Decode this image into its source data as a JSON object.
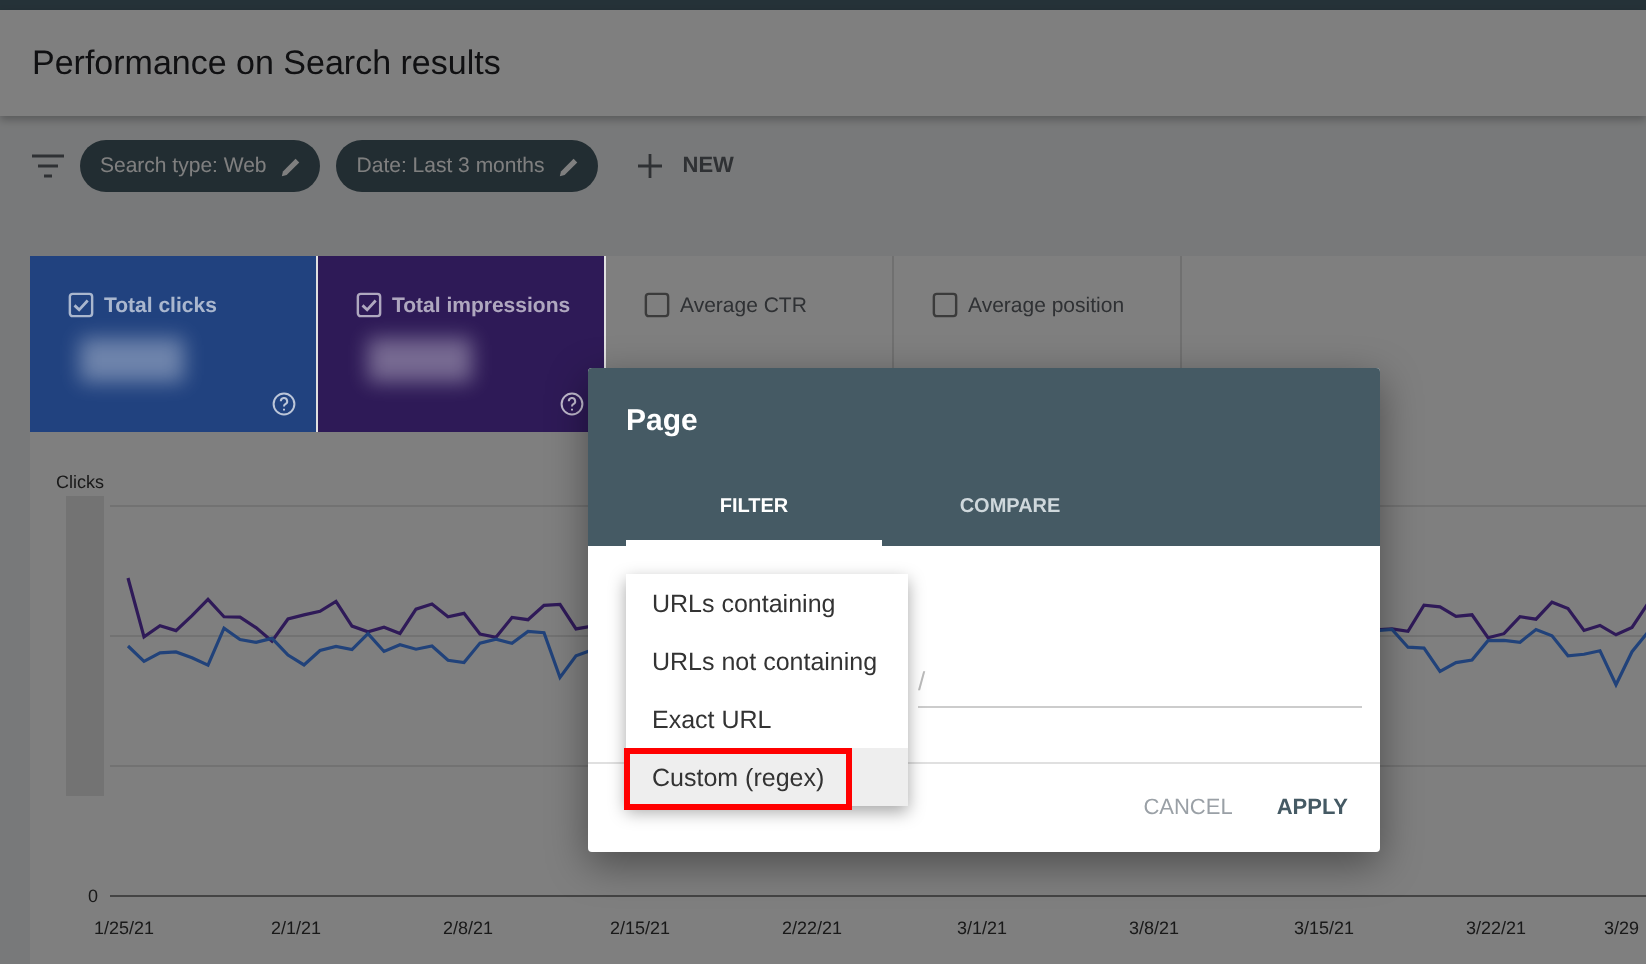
{
  "header": {
    "title": "Performance on Search results"
  },
  "filters": {
    "chips": [
      "Search type: Web",
      "Date: Last 3 months"
    ],
    "new_button": "NEW"
  },
  "metrics": [
    {
      "label": "Total clicks",
      "checked": true,
      "color": "#21427f"
    },
    {
      "label": "Total impressions",
      "checked": true,
      "color": "#2e1a57"
    },
    {
      "label": "Average CTR",
      "checked": false
    },
    {
      "label": "Average position",
      "checked": false
    }
  ],
  "chart": {
    "ylabel": "Clicks",
    "y_zero": "0",
    "x_labels": [
      "1/25/21",
      "2/1/21",
      "2/8/21",
      "2/15/21",
      "2/22/21",
      "3/1/21",
      "3/8/21",
      "3/15/21",
      "3/22/21",
      "3/29"
    ]
  },
  "dialog": {
    "title": "Page",
    "tabs": [
      {
        "label": "FILTER",
        "selected": true
      },
      {
        "label": "COMPARE",
        "selected": false
      }
    ],
    "field": {
      "placeholder": "/"
    },
    "menu": [
      {
        "label": "URLs containing",
        "highlighted": false
      },
      {
        "label": "URLs not containing",
        "highlighted": false
      },
      {
        "label": "Exact URL",
        "highlighted": false
      },
      {
        "label": "Custom (regex)",
        "highlighted": true
      }
    ],
    "buttons": [
      "CANCEL",
      "APPLY"
    ]
  }
}
